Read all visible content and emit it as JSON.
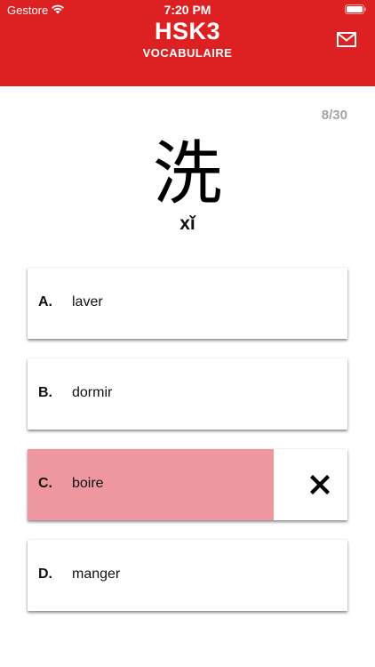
{
  "status_bar": {
    "carrier": "Gestore",
    "time": "7:20 PM"
  },
  "header": {
    "title": "HSK3",
    "subtitle": "VOCABULAIRE",
    "icon": "mail-icon"
  },
  "progress": {
    "counter": "8/30"
  },
  "question": {
    "character": "洗",
    "pinyin": "xǐ"
  },
  "options": [
    {
      "letter": "A.",
      "text": "laver",
      "state": "neutral"
    },
    {
      "letter": "B.",
      "text": "dormir",
      "state": "neutral"
    },
    {
      "letter": "C.",
      "text": "boire",
      "state": "wrong",
      "fill_fraction": 0.77,
      "icon": "x-icon"
    },
    {
      "letter": "D.",
      "text": "manger",
      "state": "neutral"
    }
  ],
  "colors": {
    "header": "#dd2122",
    "wrong_fill": "#ef97a0",
    "counter": "#a3a3a3"
  }
}
